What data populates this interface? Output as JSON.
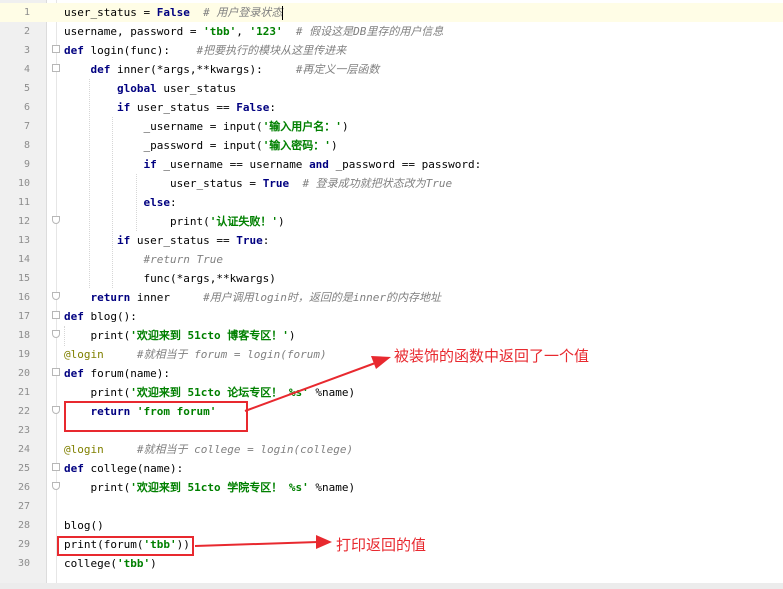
{
  "lines": [
    {
      "n": "1",
      "tokens": [
        {
          "t": "user_status = "
        },
        {
          "t": "False",
          "c": "kw"
        },
        {
          "t": "  "
        },
        {
          "t": "# 用户登录状态",
          "c": "cm"
        }
      ]
    },
    {
      "n": "2",
      "tokens": [
        {
          "t": "username, password = "
        },
        {
          "t": "'tbb'",
          "c": "str"
        },
        {
          "t": ", "
        },
        {
          "t": "'123'",
          "c": "str"
        },
        {
          "t": "  "
        },
        {
          "t": "# 假设这是DB里存的用户信息",
          "c": "cm"
        }
      ]
    },
    {
      "n": "3",
      "tokens": [
        {
          "t": "def ",
          "c": "kw"
        },
        {
          "t": "login(func):    "
        },
        {
          "t": "#把要执行的模块从这里传进来",
          "c": "cm"
        }
      ]
    },
    {
      "n": "4",
      "tokens": [
        {
          "t": "    "
        },
        {
          "t": "def ",
          "c": "kw"
        },
        {
          "t": "inner(*args,**kwargs):     "
        },
        {
          "t": "#再定义一层函数",
          "c": "cm"
        }
      ]
    },
    {
      "n": "5",
      "tokens": [
        {
          "t": "        "
        },
        {
          "t": "global ",
          "c": "kw"
        },
        {
          "t": "user_status"
        }
      ]
    },
    {
      "n": "6",
      "tokens": [
        {
          "t": "        "
        },
        {
          "t": "if ",
          "c": "kw"
        },
        {
          "t": "user_status == "
        },
        {
          "t": "False",
          "c": "kw"
        },
        {
          "t": ":"
        }
      ]
    },
    {
      "n": "7",
      "tokens": [
        {
          "t": "            _username = input("
        },
        {
          "t": "'输入用户名：'",
          "c": "str"
        },
        {
          "t": ")"
        }
      ]
    },
    {
      "n": "8",
      "tokens": [
        {
          "t": "            _password = input("
        },
        {
          "t": "'输入密码：'",
          "c": "str"
        },
        {
          "t": ")"
        }
      ]
    },
    {
      "n": "9",
      "tokens": [
        {
          "t": "            "
        },
        {
          "t": "if ",
          "c": "kw"
        },
        {
          "t": "_username == username "
        },
        {
          "t": "and ",
          "c": "kw"
        },
        {
          "t": "_password == password:"
        }
      ]
    },
    {
      "n": "10",
      "tokens": [
        {
          "t": "                user_status = "
        },
        {
          "t": "True",
          "c": "kw"
        },
        {
          "t": "  "
        },
        {
          "t": "# 登录成功就把状态改为True",
          "c": "cm"
        }
      ]
    },
    {
      "n": "11",
      "tokens": [
        {
          "t": "            "
        },
        {
          "t": "else",
          "c": "kw"
        },
        {
          "t": ":"
        }
      ]
    },
    {
      "n": "12",
      "tokens": [
        {
          "t": "                print("
        },
        {
          "t": "'认证失败！'",
          "c": "str"
        },
        {
          "t": ")"
        }
      ]
    },
    {
      "n": "13",
      "tokens": [
        {
          "t": "        "
        },
        {
          "t": "if ",
          "c": "kw"
        },
        {
          "t": "user_status == "
        },
        {
          "t": "True",
          "c": "kw"
        },
        {
          "t": ":"
        }
      ]
    },
    {
      "n": "14",
      "tokens": [
        {
          "t": "            "
        },
        {
          "t": "#return True",
          "c": "cm"
        }
      ]
    },
    {
      "n": "15",
      "tokens": [
        {
          "t": "            func(*args,**kwargs)"
        }
      ]
    },
    {
      "n": "16",
      "tokens": [
        {
          "t": "    "
        },
        {
          "t": "return ",
          "c": "kw"
        },
        {
          "t": "inner     "
        },
        {
          "t": "#用户调用login时，返回的是inner的内存地址",
          "c": "cm"
        }
      ]
    },
    {
      "n": "17",
      "tokens": [
        {
          "t": "def ",
          "c": "kw"
        },
        {
          "t": "blog():"
        }
      ]
    },
    {
      "n": "18",
      "tokens": [
        {
          "t": "    print("
        },
        {
          "t": "'欢迎来到 51cto 博客专区！'",
          "c": "str"
        },
        {
          "t": ")"
        }
      ]
    },
    {
      "n": "19",
      "tokens": [
        {
          "t": "@login",
          "c": "dec"
        },
        {
          "t": "     "
        },
        {
          "t": "#就相当于 forum = login(forum)",
          "c": "cm"
        }
      ]
    },
    {
      "n": "20",
      "tokens": [
        {
          "t": "def ",
          "c": "kw"
        },
        {
          "t": "forum(name):"
        }
      ]
    },
    {
      "n": "21",
      "tokens": [
        {
          "t": "    print("
        },
        {
          "t": "'欢迎来到 51cto 论坛专区！ %s'",
          "c": "str"
        },
        {
          "t": " %name)"
        }
      ]
    },
    {
      "n": "22",
      "tokens": [
        {
          "t": "    "
        },
        {
          "t": "return ",
          "c": "kw"
        },
        {
          "t": "'from forum'",
          "c": "str"
        }
      ]
    },
    {
      "n": "23",
      "tokens": []
    },
    {
      "n": "24",
      "tokens": [
        {
          "t": "@login",
          "c": "dec"
        },
        {
          "t": "     "
        },
        {
          "t": "#就相当于 college = login(college)",
          "c": "cm"
        }
      ]
    },
    {
      "n": "25",
      "tokens": [
        {
          "t": "def ",
          "c": "kw"
        },
        {
          "t": "college(name):"
        }
      ]
    },
    {
      "n": "26",
      "tokens": [
        {
          "t": "    print("
        },
        {
          "t": "'欢迎来到 51cto 学院专区！ %s'",
          "c": "str"
        },
        {
          "t": " %name)"
        }
      ]
    },
    {
      "n": "27",
      "tokens": []
    },
    {
      "n": "28",
      "tokens": [
        {
          "t": "blog()"
        }
      ]
    },
    {
      "n": "29",
      "tokens": [
        {
          "t": "print(forum("
        },
        {
          "t": "'tbb'",
          "c": "str"
        },
        {
          "t": "))"
        }
      ]
    },
    {
      "n": "30",
      "tokens": [
        {
          "t": "college("
        },
        {
          "t": "'tbb'",
          "c": "str"
        },
        {
          "t": ")"
        }
      ]
    }
  ],
  "annotations": {
    "note1": "被装饰的函数中返回了一个值",
    "note2": "打印返回的值"
  },
  "colors": {
    "keyword": "#000080",
    "string": "#008000",
    "comment": "#808080",
    "decorator": "#808000",
    "annotation": "#e8292f"
  }
}
